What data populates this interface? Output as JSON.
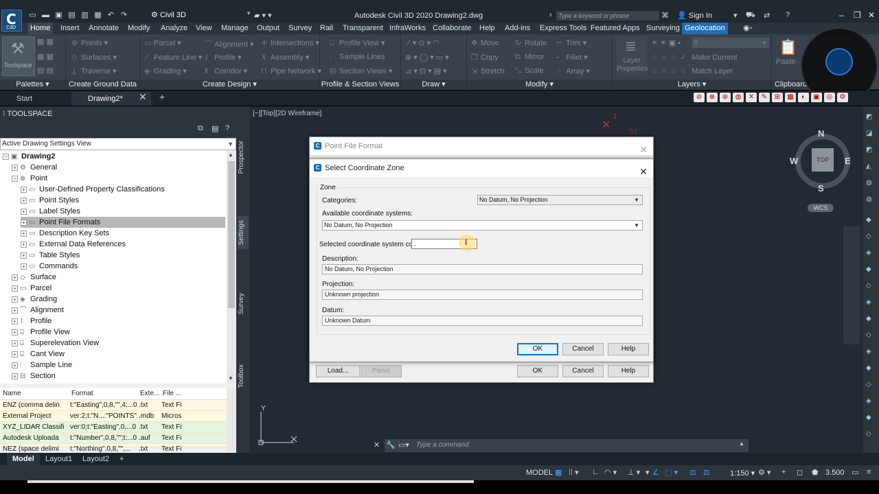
{
  "titlebar": {
    "workspace": "Civil 3D",
    "title": "Autodesk Civil 3D 2020    Drawing2.dwg",
    "search_placeholder": "Type a keyword or phrase",
    "sign_in": "Sign In",
    "logo_text": "C",
    "logo_sub": "C3D"
  },
  "ribbon_tabs": [
    "Home",
    "Insert",
    "Annotate",
    "Modify",
    "Analyze",
    "View",
    "Manage",
    "Output",
    "Survey",
    "Rail",
    "Transparent",
    "InfraWorks",
    "Collaborate",
    "Help",
    "Add-ins",
    "Express Tools",
    "Featured Apps",
    "Surveying",
    "Geolocation"
  ],
  "ribbon": {
    "toolspace_label": "Toolspace",
    "panels": {
      "palettes": "Palettes",
      "create_ground": "Create Ground Data",
      "create_design": "Create Design",
      "profile_section": "Profile & Section Views",
      "draw": "Draw",
      "modify": "Modify",
      "layers": "Layers",
      "clipboard": "Clipboard"
    },
    "items": {
      "points": "Points",
      "surfaces": "Surfaces",
      "traverse": "Traverse",
      "parcel": "Parcel",
      "feature_line": "Feature Line",
      "grading": "Grading",
      "alignment": "Alignment",
      "profile": "Profile",
      "corridor": "Corridor",
      "intersections": "Intersections",
      "assembly": "Assembly",
      "pipe_network": "Pipe Network",
      "profile_view": "Profile View",
      "sample_lines": "Sample Lines",
      "section_views": "Section Views",
      "move": "Move",
      "copy": "Copy",
      "stretch": "Stretch",
      "rotate": "Rotate",
      "mirror": "Mirror",
      "scale": "Scale",
      "trim": "Trim",
      "fillet": "Fillet",
      "array": "Array",
      "layer_properties": "Layer Properties",
      "make_current": "Make Current",
      "match_layer": "Match Layer",
      "paste": "Paste",
      "layer_value": "0"
    }
  },
  "file_tabs": {
    "start": "Start",
    "drawing": "Drawing2*"
  },
  "toolspace": {
    "title": "TOOLSPACE",
    "view": "Active Drawing Settings View",
    "vertical_tabs": [
      "Prospector",
      "Settings",
      "Survey",
      "Toolbox"
    ],
    "tree": [
      {
        "label": "Drawing2",
        "level": 0
      },
      {
        "label": "General",
        "level": 1
      },
      {
        "label": "Point",
        "level": 1
      },
      {
        "label": "User-Defined Property Classifications",
        "level": 2
      },
      {
        "label": "Point Styles",
        "level": 2
      },
      {
        "label": "Label Styles",
        "level": 2
      },
      {
        "label": "Point File Formats",
        "level": 2
      },
      {
        "label": "Description Key Sets",
        "level": 2
      },
      {
        "label": "External Data References",
        "level": 2
      },
      {
        "label": "Table Styles",
        "level": 2
      },
      {
        "label": "Commands",
        "level": 2
      },
      {
        "label": "Surface",
        "level": 1
      },
      {
        "label": "Parcel",
        "level": 1
      },
      {
        "label": "Grading",
        "level": 1
      },
      {
        "label": "Alignment",
        "level": 1
      },
      {
        "label": "Profile",
        "level": 1
      },
      {
        "label": "Profile View",
        "level": 1
      },
      {
        "label": "Superelevation View",
        "level": 1
      },
      {
        "label": "Cant View",
        "level": 1
      },
      {
        "label": "Sample Line",
        "level": 1
      },
      {
        "label": "Section",
        "level": 1
      }
    ],
    "list_headers": [
      "Name",
      "Format",
      "Exte...",
      "File ..."
    ],
    "list_rows": [
      {
        "name": "ENZ (comma delin",
        "format": "t:\"Easting\",0,8,\"\",4;...0",
        "ext": ".txt",
        "file": "Text Fi"
      },
      {
        "name": "External Project",
        "format": "ver:2;t:\"N...:\"POINTS\";",
        "ext": ".mdb",
        "file": "Micros"
      },
      {
        "name": "XYZ_LIDAR Classifi",
        "format": "ver:0;t:\"Easting\",0,...0",
        "ext": ".txt",
        "file": "Text Fi"
      },
      {
        "name": "Autodesk Uploada",
        "format": "t:\"Number\",0,8,\"\";t:...0",
        "ext": ".auf",
        "file": "Text Fi"
      },
      {
        "name": "NEZ (space delimi",
        "format": "t:\"Northing\",0,8,\"\",...",
        "ext": ".txt",
        "file": "Text Fi"
      }
    ]
  },
  "viewport": {
    "label": "[−][Top][2D Wireframe]",
    "compass": {
      "n": "N",
      "s": "S",
      "e": "E",
      "w": "W",
      "top": "TOP"
    },
    "wcs": "WCS",
    "marker_1": "1",
    "marker_53": "53",
    "ucs_y": "Y"
  },
  "command_line": {
    "placeholder": "Type a command"
  },
  "layout_tabs": [
    "Model",
    "Layout1",
    "Layout2"
  ],
  "statusbar": {
    "model": "MODEL",
    "scale": "1:150",
    "weight": "3.500"
  },
  "dialog_pff": {
    "title": "Point File Format",
    "load": "Load...",
    "parse": "Parse",
    "ok": "OK",
    "cancel": "Cancel",
    "help": "Help"
  },
  "dialog_zone": {
    "title": "Select Coordinate Zone",
    "group": "Zone",
    "categories_label": "Categories:",
    "categories_value": "No Datum, No Projection",
    "available_label": "Available coordinate systems:",
    "available_value": "No Datum, No Projection",
    "code_label": "Selected coordinate system code:",
    "code_value": ".",
    "description_label": "Description:",
    "description_value": "No Datum, No Projection",
    "projection_label": "Projection:",
    "projection_value": "Unknown projection",
    "datum_label": "Datum:",
    "datum_value": "Unknown Datum",
    "ok": "OK",
    "cancel": "Cancel",
    "help": "Help"
  },
  "colors": {
    "accent": "#1e6fb4",
    "canvas": "#232a33",
    "selection": "#b7b7b7"
  }
}
